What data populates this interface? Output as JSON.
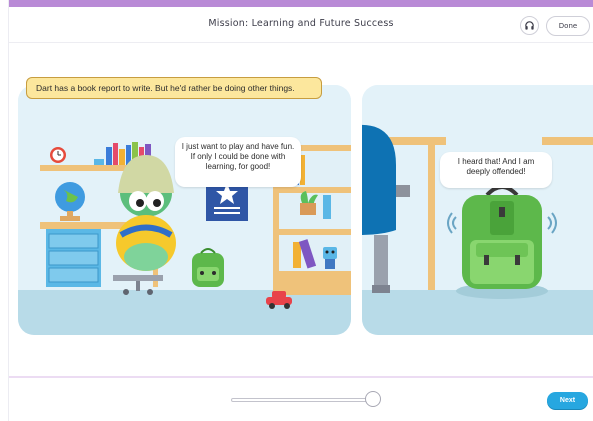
{
  "header": {
    "title": "Mission: Learning and Future Success",
    "done_label": "Done",
    "audio_icon": "headphones-icon"
  },
  "caption": {
    "text": "Dart has a book report to write. But he'd rather be doing other things."
  },
  "panel1": {
    "speech": "I just want to play and have fun. If only I could be done with learning, for good!"
  },
  "panel2": {
    "speech": "I heard that! And I am deeply offended!"
  },
  "footer": {
    "next_label": "Next",
    "progress_fraction": 1.0
  },
  "colors": {
    "accent_top": "#b98ad6",
    "next_button": "#27a7e0",
    "caption_bg": "#fce79d",
    "panel_bg": "#e6f3f9"
  }
}
